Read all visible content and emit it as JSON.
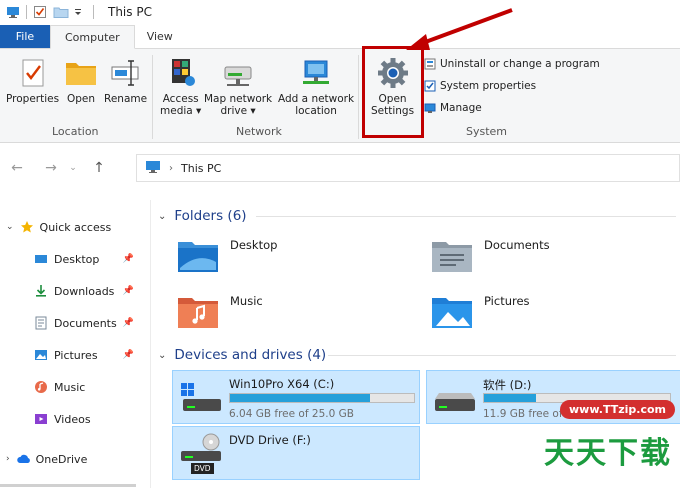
{
  "window": {
    "title": "This PC"
  },
  "ribbon": {
    "tabs": [
      {
        "label": "File"
      },
      {
        "label": "Computer"
      },
      {
        "label": "View"
      }
    ],
    "location": {
      "label": "Location",
      "properties": "Properties",
      "open": "Open",
      "rename": "Rename"
    },
    "network": {
      "label": "Network",
      "access_media_1": "Access",
      "access_media_2": "media ▾",
      "map_drive_1": "Map network",
      "map_drive_2": "drive ▾",
      "add_location_1": "Add a network",
      "add_location_2": "location"
    },
    "system": {
      "label": "System",
      "open_settings_1": "Open",
      "open_settings_2": "Settings",
      "uninstall": "Uninstall or change a program",
      "system_properties": "System properties",
      "manage": "Manage"
    }
  },
  "address": {
    "path": "This PC"
  },
  "sidebar": {
    "quick_access": "Quick access",
    "items": [
      {
        "label": "Desktop"
      },
      {
        "label": "Downloads"
      },
      {
        "label": "Documents"
      },
      {
        "label": "Pictures"
      },
      {
        "label": "Music"
      },
      {
        "label": "Videos"
      }
    ],
    "onedrive": "OneDrive"
  },
  "content": {
    "folders_header": "Folders (6)",
    "folders": [
      {
        "label": "Desktop"
      },
      {
        "label": "Documents"
      },
      {
        "label": "Music"
      },
      {
        "label": "Pictures"
      }
    ],
    "devices_header": "Devices and drives (4)",
    "drives": [
      {
        "label": "Win10Pro X64 (C:)",
        "free": "6.04 GB free of 25.0 GB",
        "used_fraction": 0.76
      },
      {
        "label": "软件 (D:)",
        "free": "11.9 GB free of",
        "used_fraction": 0.28
      },
      {
        "label": "DVD Drive (F:)",
        "badge": "DVD"
      }
    ]
  },
  "watermark": {
    "url": "www.TTzip.com",
    "text": "天天下载"
  },
  "colors": {
    "accent": "#1a5fb4",
    "highlight": "#c00000",
    "selection": "#cce8ff",
    "drive_fill": "#26a0da"
  }
}
